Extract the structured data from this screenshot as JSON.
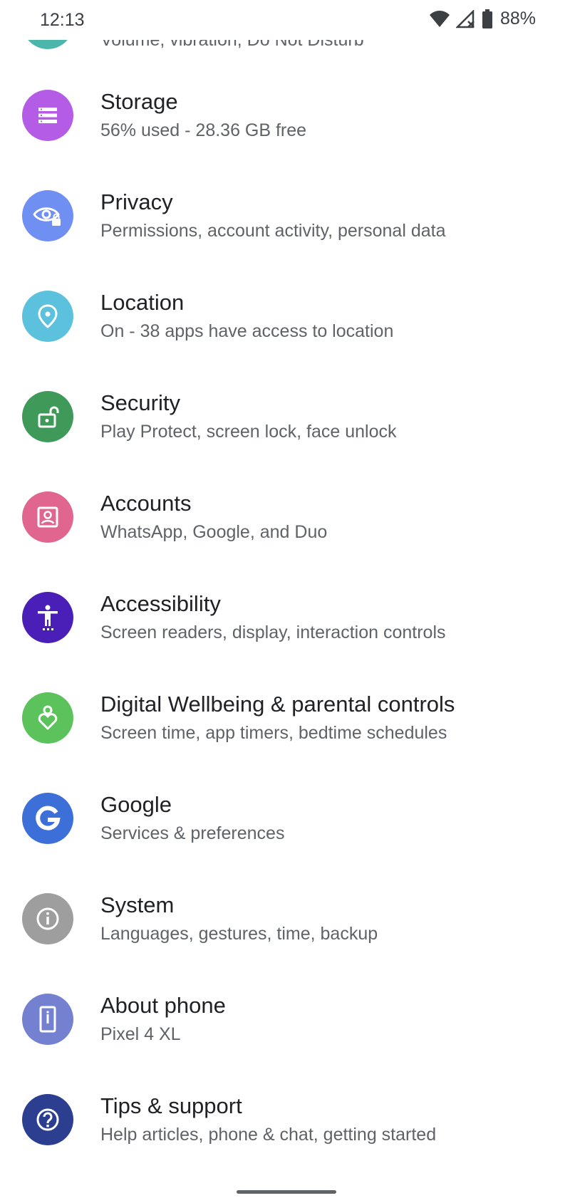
{
  "status_bar": {
    "time": "12:13",
    "battery_percent": "88%",
    "icons": [
      "wifi-icon",
      "cellular-no-signal-icon",
      "battery-icon"
    ]
  },
  "partial_item": {
    "subtitle": "Volume, vibration, Do Not Disturb",
    "icon": "sound-icon",
    "color": "#4db6ac"
  },
  "settings": [
    {
      "title": "Storage",
      "subtitle": "56% used - 28.36 GB free",
      "icon": "storage-icon",
      "color": "#b55ce6"
    },
    {
      "title": "Privacy",
      "subtitle": "Permissions, account activity, personal data",
      "icon": "privacy-eye-icon",
      "color": "#6f8ff2"
    },
    {
      "title": "Location",
      "subtitle": "On - 38 apps have access to location",
      "icon": "location-pin-icon",
      "color": "#5bc1dc"
    },
    {
      "title": "Security",
      "subtitle": "Play Protect, screen lock, face unlock",
      "icon": "unlock-icon",
      "color": "#3f9a5a"
    },
    {
      "title": "Accounts",
      "subtitle": "WhatsApp, Google, and Duo",
      "icon": "account-box-icon",
      "color": "#e0668f"
    },
    {
      "title": "Accessibility",
      "subtitle": "Screen readers, display, interaction controls",
      "icon": "accessibility-icon",
      "color": "#4a1fb8"
    },
    {
      "title": "Digital Wellbeing & parental controls",
      "subtitle": "Screen time, app timers, bedtime schedules",
      "icon": "wellbeing-heart-icon",
      "color": "#5cc35c"
    },
    {
      "title": "Google",
      "subtitle": "Services & preferences",
      "icon": "google-g-icon",
      "color": "#3c6fd8"
    },
    {
      "title": "System",
      "subtitle": "Languages, gestures, time, backup",
      "icon": "info-icon",
      "color": "#9e9e9e"
    },
    {
      "title": "About phone",
      "subtitle": "Pixel 4 XL",
      "icon": "phone-icon",
      "color": "#7480d0"
    },
    {
      "title": "Tips & support",
      "subtitle": "Help articles, phone & chat, getting started",
      "icon": "help-icon",
      "color": "#2c3e8f"
    }
  ]
}
